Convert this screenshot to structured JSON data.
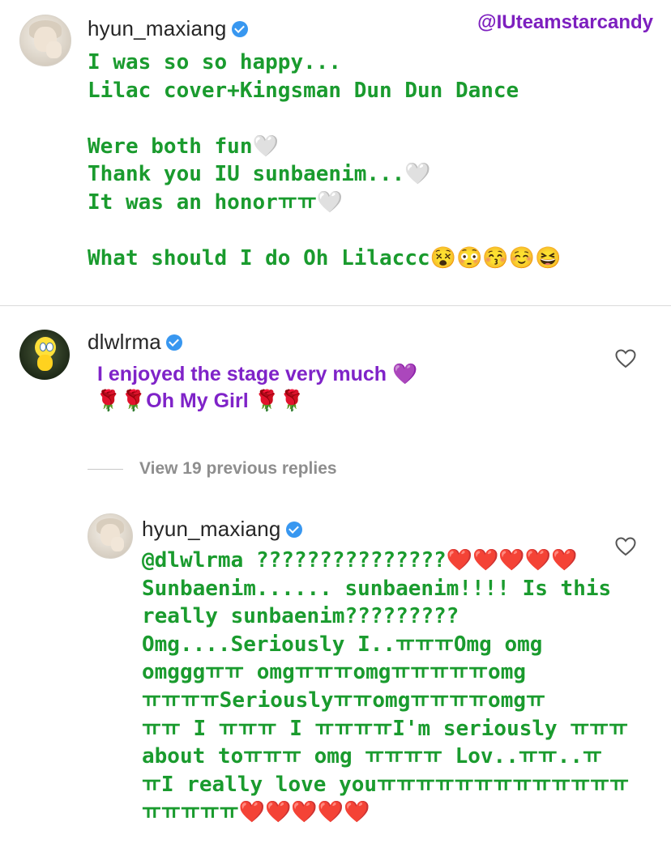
{
  "watermark": "@IUteamstarcandy",
  "post": {
    "username": "hyun_maxiang",
    "avatar_icon": "profile-photo",
    "verified_icon": "verified-badge-icon",
    "text": "I was so so happy...\nLilac cover+Kingsman Dun Dun Dance\n\nWere both fun🤍\nThank you IU sunbaenim...🤍\nIt was an honorㅠㅠ🤍\n\nWhat should I do Oh Lilaccc😵😳😚☺️😆",
    "text_color": "#1a9b2e"
  },
  "comment": {
    "username": "dlwlrma",
    "avatar_icon": "tweety-bird-avatar",
    "line1": "I enjoyed the stage very much 💜",
    "line2": "🌹🌹Oh My Girl 🌹🌹",
    "text_color": "#7f23c8",
    "like_icon": "heart-outline-icon"
  },
  "view_replies": "View 19 previous replies",
  "reply": {
    "username": "hyun_maxiang",
    "avatar_icon": "profile-photo",
    "text": "@dlwlrma ???????????????❤️❤️❤️❤️❤️\nSunbaenim...... sunbaenim!!!! Is this\nreally sunbaenim?????????\nOmg....Seriously I..ㅠㅠㅠOmg omg\nomgggㅠㅠ omgㅠㅠㅠomgㅠㅠㅠㅠㅠomg\nㅠㅠㅠㅠSeriouslyㅠㅠomgㅠㅠㅠㅠomgㅠ\nㅠㅠ I ㅠㅠㅠ I ㅠㅠㅠㅠI'm seriously ㅠㅠㅠ\nabout toㅠㅠㅠ omg ㅠㅠㅠㅠ Lov..ㅠㅠ..ㅠ\nㅠI really love youㅠㅠㅠㅠㅠㅠㅠㅠㅠㅠㅠㅠㅠ\nㅠㅠㅠㅠㅠ❤️❤️❤️❤️❤️",
    "text_color": "#1a9b2e",
    "like_icon": "heart-outline-icon"
  }
}
